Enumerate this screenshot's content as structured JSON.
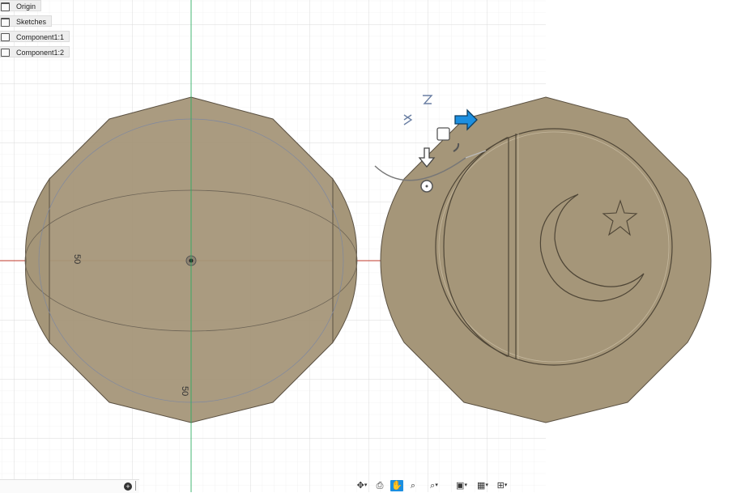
{
  "browser": {
    "items": [
      {
        "label": "Origin",
        "icon": "folder-icon"
      },
      {
        "label": "Sketches",
        "icon": "folder-icon"
      },
      {
        "label": "Component1:1",
        "icon": "component-icon"
      },
      {
        "label": "Component1:2",
        "icon": "component-icon"
      }
    ]
  },
  "sketch": {
    "dimension_horizontal": "50",
    "dimension_vertical": "50"
  },
  "colors": {
    "part_fill": "#a59679",
    "part_edge": "#5b5142",
    "x_axis": "#c0392b",
    "y_axis": "#27ae60",
    "accent": "#1c8fe0"
  },
  "nav_toolbar": {
    "items": [
      {
        "name": "orbit-icon",
        "glyph": "✥",
        "dropdown": true
      },
      {
        "name": "look-at-icon",
        "glyph": "⎙",
        "dropdown": false
      },
      {
        "name": "pan-icon",
        "glyph": "✋",
        "dropdown": false,
        "active": true
      },
      {
        "name": "zoom-icon",
        "glyph": "🔍",
        "dropdown": false
      },
      {
        "name": "fit-icon",
        "glyph": "⌕",
        "dropdown": true
      },
      {
        "name": "display-settings-icon",
        "glyph": "▣",
        "dropdown": true
      },
      {
        "name": "grid-settings-icon",
        "glyph": "▦",
        "dropdown": true
      },
      {
        "name": "viewports-icon",
        "glyph": "⊞",
        "dropdown": true
      }
    ]
  }
}
